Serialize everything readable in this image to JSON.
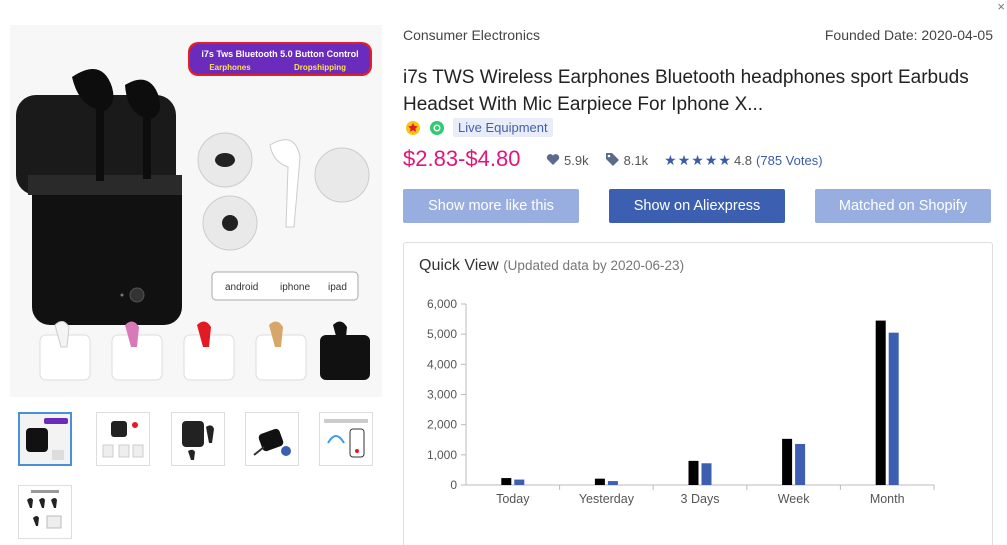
{
  "product": {
    "category": "Consumer Electronics",
    "founded": "Founded Date: 2020-04-05",
    "title": "i7s TWS Wireless Earphones Bluetooth headphones sport Earbuds Headset With Mic Earpiece For Iphone X...",
    "tag": "Live Equipment",
    "price": "$2.83-$4.80",
    "likes": "5.9k",
    "orders": "8.1k",
    "rating": "4.8",
    "votes": "(785 Votes)",
    "rating_fraction": 0.96
  },
  "image_banner": {
    "line1": "i7s Tws Bluetooth 5.0  Button Control",
    "line2a": "Earphones",
    "line2b": "Dropshipping",
    "platforms": [
      "android",
      "iphone",
      "ipad"
    ]
  },
  "buttons": {
    "more": "Show more like this",
    "aliexpress": "Show on Aliexpress",
    "shopify": "Matched on Shopify"
  },
  "quick_view": {
    "title": "Quick View",
    "updated": "(Updated data by 2020-06-23)"
  },
  "colors": {
    "accent": "#3d5fb2",
    "price": "#e3147a",
    "bar_a": "#000000",
    "bar_b": "#3d5fb2"
  },
  "chart_data": {
    "type": "bar",
    "categories": [
      "Today",
      "Yesterday",
      "3 Days",
      "Week",
      "Month"
    ],
    "series": [
      {
        "values": [
          230,
          210,
          800,
          1530,
          5450
        ]
      },
      {
        "values": [
          180,
          130,
          720,
          1360,
          5050
        ]
      }
    ],
    "ylim": [
      0,
      6000
    ],
    "yticks": [
      "0",
      "1,000",
      "2,000",
      "3,000",
      "4,000",
      "5,000",
      "6,000"
    ],
    "grid": false
  }
}
